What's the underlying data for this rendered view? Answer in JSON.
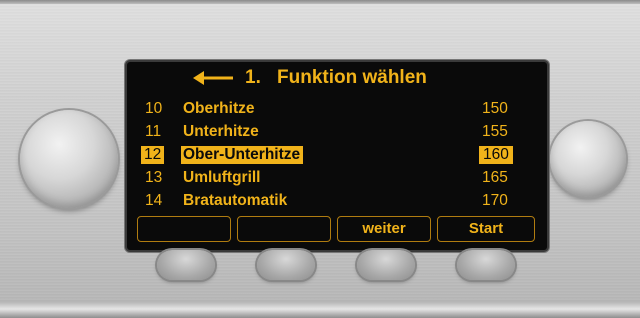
{
  "header": {
    "number": "1.",
    "title": "Funktion wählen",
    "back_icon": "arrow-left-icon"
  },
  "rows": [
    {
      "num": "10",
      "name": "Oberhitze",
      "value": "150"
    },
    {
      "num": "11",
      "name": "Unterhitze",
      "value": "155"
    },
    {
      "num": "12",
      "name": "Ober-Unterhitze",
      "value": "160",
      "selected": true
    },
    {
      "num": "13",
      "name": "Umluftgrill",
      "value": "165"
    },
    {
      "num": "14",
      "name": "Bratautomatik",
      "value": "170"
    }
  ],
  "softkeys": [
    "",
    "",
    "weiter",
    "Start"
  ],
  "colors": {
    "display_text": "#f1b31a",
    "display_bg": "#0a0a0a",
    "softkey_border": "#b07c10"
  }
}
